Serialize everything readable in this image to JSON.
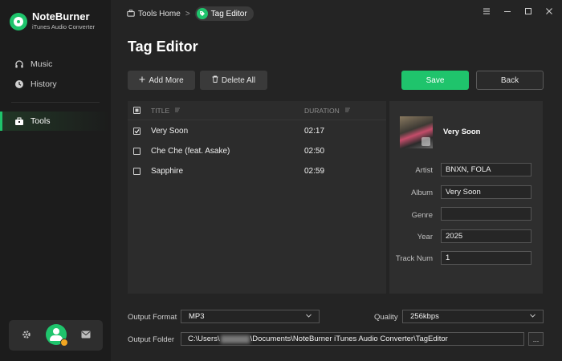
{
  "app": {
    "name": "NoteBurner",
    "subtitle": "iTunes Audio Converter"
  },
  "sidebar": {
    "items": [
      {
        "label": "Music",
        "icon": "headphones-icon"
      },
      {
        "label": "History",
        "icon": "clock-icon"
      },
      {
        "label": "Tools",
        "icon": "toolbox-icon",
        "active": true
      }
    ]
  },
  "breadcrumb": {
    "home": "Tools Home",
    "separator": ">",
    "current": "Tag Editor"
  },
  "page": {
    "title": "Tag Editor"
  },
  "toolbar": {
    "add_label": "Add More",
    "delete_label": "Delete All",
    "save_label": "Save",
    "back_label": "Back"
  },
  "table": {
    "columns": [
      "TITLE",
      "DURATION"
    ],
    "rows": [
      {
        "title": "Very Soon",
        "duration": "02:17",
        "checked": true
      },
      {
        "title": "Che Che (feat. Asake)",
        "duration": "02:50",
        "checked": false
      },
      {
        "title": "Sapphire",
        "duration": "02:59",
        "checked": false
      }
    ]
  },
  "detail": {
    "track_title": "Very Soon",
    "fields": [
      {
        "label": "Artist",
        "value": "BNXN, FOLA"
      },
      {
        "label": "Album",
        "value": "Very Soon"
      },
      {
        "label": "Genre",
        "value": ""
      },
      {
        "label": "Year",
        "value": "2025"
      },
      {
        "label": "Track Num",
        "value": "1"
      }
    ]
  },
  "output": {
    "format_label": "Output Format",
    "format_value": "MP3",
    "quality_label": "Quality",
    "quality_value": "256kbps",
    "folder_label": "Output Folder",
    "folder_prefix": "C:\\Users\\",
    "folder_suffix": "\\Documents\\NoteBurner iTunes Audio Converter\\TagEditor",
    "more_label": "..."
  },
  "colors": {
    "accent": "#1fc46c",
    "sidebar_bg": "#1c1c1c",
    "main_bg": "#242424",
    "panel_bg": "#2c2c2c"
  }
}
